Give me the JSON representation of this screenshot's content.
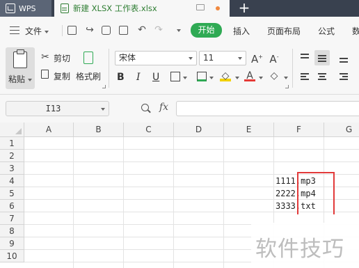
{
  "tabs": {
    "app_label": "WPS",
    "doc_label": "新建 XLSX 工作表.xlsx",
    "new_tab": "+"
  },
  "menu": {
    "file_label": "文件",
    "items": [
      "开始",
      "插入",
      "页面布局",
      "公式",
      "数"
    ]
  },
  "ribbon": {
    "paste_label": "粘贴",
    "cut_label": "剪切",
    "copy_label": "复制",
    "format_painter_label": "格式刷",
    "font_name": "宋体",
    "font_size": "11",
    "bold": "B",
    "italic": "I",
    "underline": "U"
  },
  "formula_bar": {
    "name_box": "I13",
    "fx_label": "fx",
    "formula": ""
  },
  "sheet": {
    "columns": [
      "A",
      "B",
      "C",
      "D",
      "E",
      "F",
      "G"
    ],
    "rows": [
      "1",
      "2",
      "3",
      "4",
      "5",
      "6",
      "7",
      "8",
      "9",
      "10"
    ],
    "cells": [
      {
        "ref": "F4",
        "value": "1111.mp3"
      },
      {
        "ref": "F5",
        "value": "2222.mp4"
      },
      {
        "ref": "F6",
        "value": "3333.txt"
      }
    ]
  },
  "watermark": "软件技巧",
  "colors": {
    "accent_green": "#2faa54",
    "title_bar": "#39414f",
    "highlight_red": "#e23a3a"
  }
}
